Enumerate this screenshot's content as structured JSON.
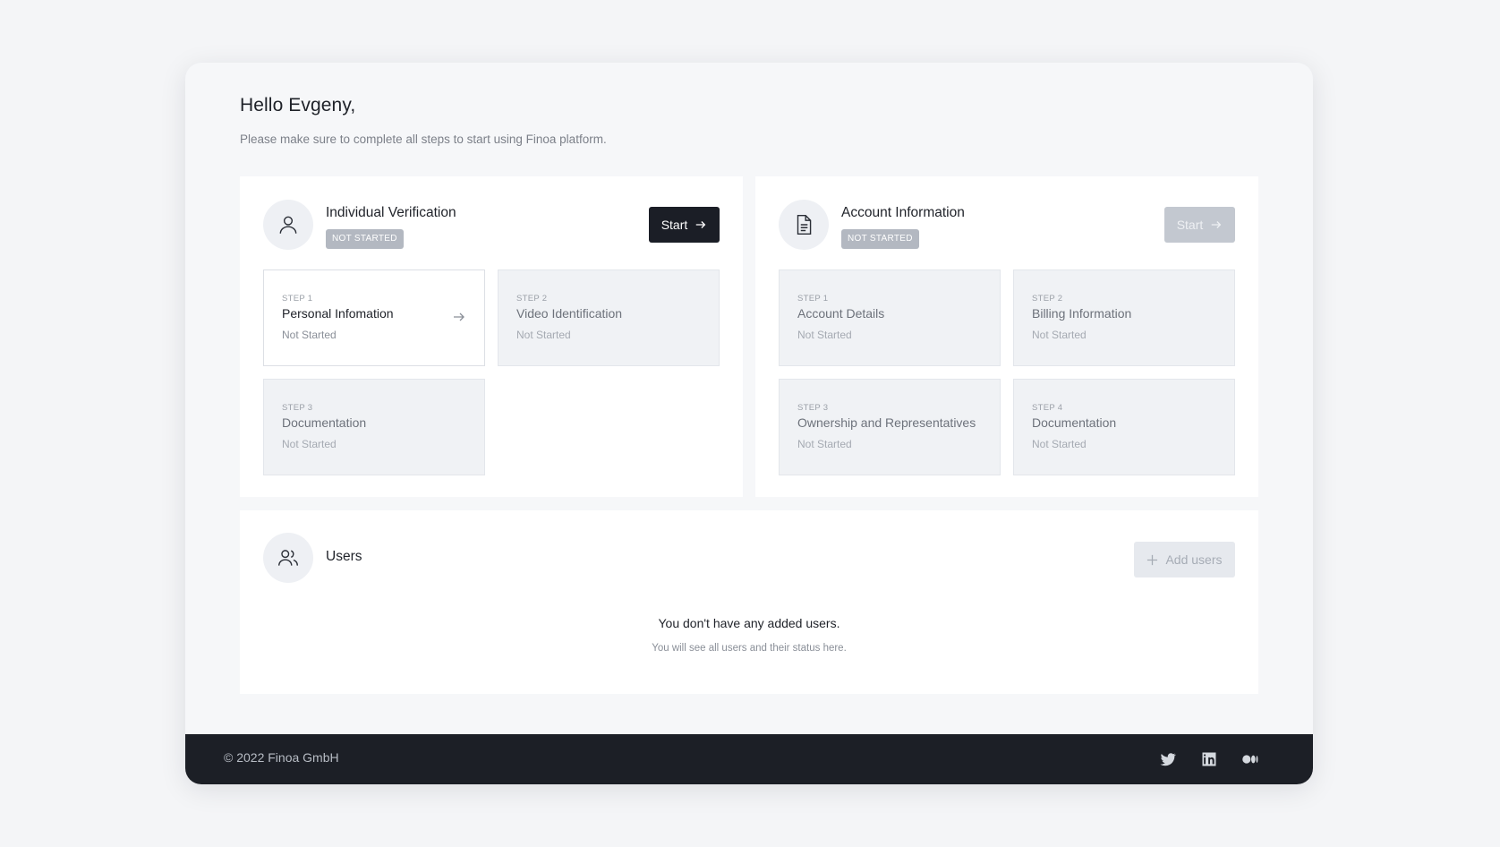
{
  "header": {
    "greeting": "Hello Evgeny,",
    "subtitle": "Please make sure to complete all steps to start using Finoa platform."
  },
  "individual_verification": {
    "icon": "user-icon",
    "title": "Individual Verification",
    "status_badge": "NOT STARTED",
    "start_label": "Start",
    "steps": [
      {
        "step": "STEP 1",
        "title": "Personal Infomation",
        "status": "Not Started",
        "active": true
      },
      {
        "step": "STEP 2",
        "title": "Video Identification",
        "status": "Not Started",
        "active": false
      },
      {
        "step": "STEP 3",
        "title": "Documentation",
        "status": "Not Started",
        "active": false
      }
    ]
  },
  "account_information": {
    "icon": "document-icon",
    "title": "Account Information",
    "status_badge": "NOT STARTED",
    "start_label": "Start",
    "steps": [
      {
        "step": "STEP 1",
        "title": "Account Details",
        "status": "Not Started",
        "active": false
      },
      {
        "step": "STEP 2",
        "title": "Billing Information",
        "status": "Not Started",
        "active": false
      },
      {
        "step": "STEP 3",
        "title": "Ownership and Representatives",
        "status": "Not Started",
        "active": false
      },
      {
        "step": "STEP 4",
        "title": "Documentation",
        "status": "Not Started",
        "active": false
      }
    ]
  },
  "users": {
    "icon": "users-icon",
    "title": "Users",
    "add_label": "Add users",
    "empty_title": "You don't have any added users.",
    "empty_subtitle": "You will see all users and their status here."
  },
  "footer": {
    "copyright": "© 2022 Finoa GmbH",
    "social": [
      "twitter-icon",
      "linkedin-icon",
      "medium-icon"
    ]
  },
  "colors": {
    "page_bg": "#f4f5f7",
    "primary_button": "#1b1e26",
    "disabled_button": "#c3c8d0",
    "badge": "#b3b8c1",
    "footer_bg": "#1c1f26"
  }
}
